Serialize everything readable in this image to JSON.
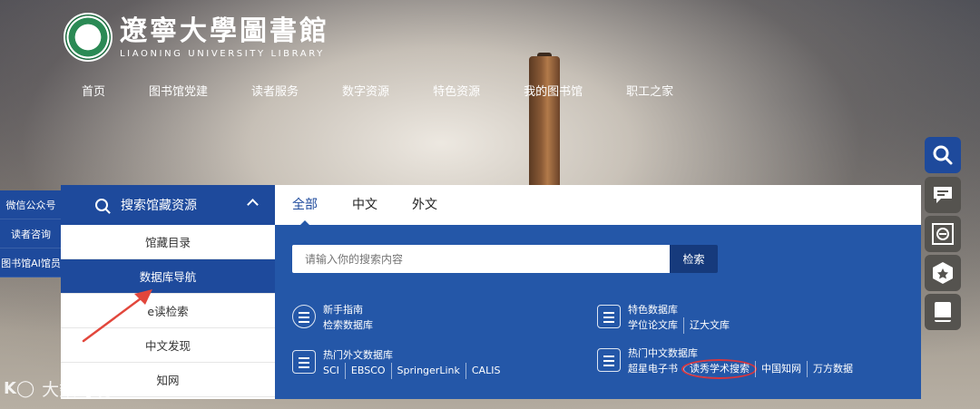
{
  "logo": {
    "title_cn": "遼寧大學圖書館",
    "title_en": "LIAONING UNIVERSITY LIBRARY"
  },
  "nav": [
    "首页",
    "图书馆党建",
    "读者服务",
    "数字资源",
    "特色资源",
    "我的图书馆",
    "职工之家"
  ],
  "quick_links": [
    "微信公众号",
    "读者咨询",
    "图书馆AI馆员"
  ],
  "sidebar": {
    "header": "搜索馆藏资源",
    "items": [
      "馆藏目录",
      "数据库导航",
      "e读检索",
      "中文发现",
      "知网"
    ],
    "active_index": 1
  },
  "tabs": {
    "items": [
      "全部",
      "中文",
      "外文"
    ],
    "active_index": 0
  },
  "search": {
    "placeholder": "请输入你的搜索内容",
    "button": "检索"
  },
  "blocks": {
    "newbie": {
      "title": "新手指南",
      "links": [
        "检索数据库"
      ]
    },
    "special": {
      "title": "特色数据库",
      "links": [
        "学位论文库",
        "辽大文库"
      ]
    },
    "foreign": {
      "title": "热门外文数据库",
      "links": [
        "SCI",
        "EBSCO",
        "SpringerLink",
        "CALIS"
      ]
    },
    "chinese": {
      "title": "热门中文数据库",
      "links": [
        "超星电子书",
        "读秀学术搜索",
        "中国知网",
        "万方数据"
      ]
    }
  },
  "float_icons": [
    "search-icon",
    "chat-icon",
    "ebook-icon",
    "badge-icon",
    "book-icon"
  ],
  "watermark": {
    "logo": "K◯",
    "text": "大数跨境"
  },
  "colors": {
    "primary": "#1e4a9c",
    "panel": "#2457a8",
    "accent_red": "#d8353d"
  }
}
